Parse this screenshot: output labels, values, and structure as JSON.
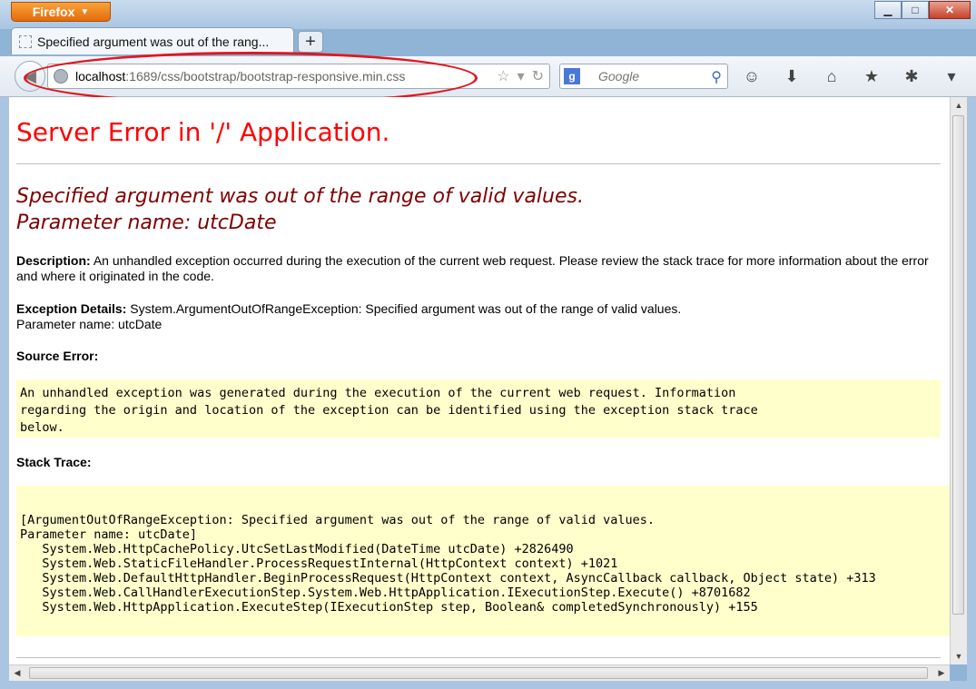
{
  "browser": {
    "menu_button": "Firefox",
    "tab_title": "Specified argument was out of the rang...",
    "new_tab_label": "+",
    "url_host": "localhost",
    "url_rest": ":1689/css/bootstrap/bootstrap-responsive.min.css",
    "search_placeholder": "Google",
    "search_engine_letter": "g",
    "colors": {
      "annotation": "#e0171e",
      "firefox_orange": "#e56b0a"
    }
  },
  "page": {
    "title": "Server Error in '/' Application.",
    "error_message_line1": "Specified argument was out of the range of valid values.",
    "error_message_line2": "Parameter name: utcDate",
    "description_label": "Description:",
    "description_text": "An unhandled exception occurred during the execution of the current web request. Please review the stack trace for more information about the error and where it originated in the code.",
    "exception_label": "Exception Details:",
    "exception_text_line1": "System.ArgumentOutOfRangeException: Specified argument was out of the range of valid values.",
    "exception_text_line2": "Parameter name: utcDate",
    "source_error_label": "Source Error:",
    "source_error_text": "An unhandled exception was generated during the execution of the current web request. Information\nregarding the origin and location of the exception can be identified using the exception stack trace\nbelow.",
    "stack_trace_label": "Stack Trace:",
    "stack_trace_text": "[ArgumentOutOfRangeException: Specified argument was out of the range of valid values.\nParameter name: utcDate]\n   System.Web.HttpCachePolicy.UtcSetLastModified(DateTime utcDate) +2826490\n   System.Web.StaticFileHandler.ProcessRequestInternal(HttpContext context) +1021\n   System.Web.DefaultHttpHandler.BeginProcessRequest(HttpContext context, AsyncCallback callback, Object state) +313\n   System.Web.CallHandlerExecutionStep.System.Web.HttpApplication.IExecutionStep.Execute() +8701682\n   System.Web.HttpApplication.ExecuteStep(IExecutionStep step, Boolean& completedSynchronously) +155",
    "colors": {
      "title": "#ff0000",
      "message": "#800000",
      "code_bg": "#ffffcc"
    }
  }
}
